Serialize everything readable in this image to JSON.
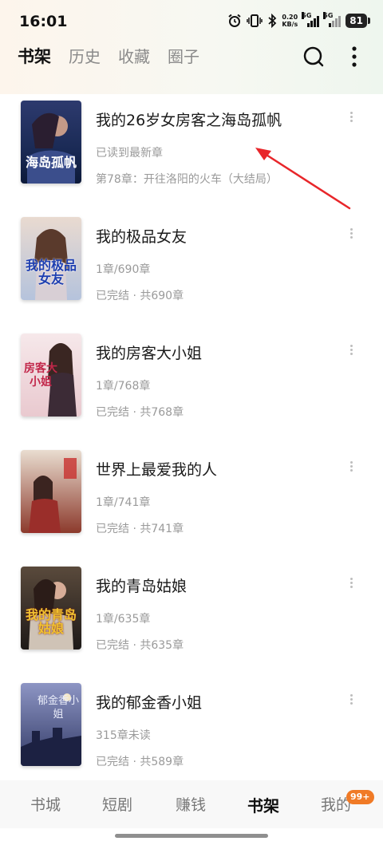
{
  "status_bar": {
    "time": "16:01",
    "net_speed_value": "0.20",
    "net_speed_unit": "KB/s",
    "sig1_label": "5G",
    "sig2_label": "5G",
    "battery": "81",
    "icons": [
      "alarm-icon",
      "vibrate-icon",
      "bluetooth-icon",
      "signal-icon",
      "signal-icon",
      "battery-icon"
    ]
  },
  "top_tabs": [
    {
      "label": "书架",
      "active": true
    },
    {
      "label": "历史",
      "active": false
    },
    {
      "label": "收藏",
      "active": false
    },
    {
      "label": "圈子",
      "active": false
    }
  ],
  "books": [
    {
      "title": "我的26岁女房客之海岛孤帆",
      "line1": "已读到最新章",
      "line2": "第78章：开往洛阳的火车（大结局）",
      "cover_text": "海岛孤帆"
    },
    {
      "title": "我的极品女友",
      "line1": "1章/690章",
      "line2": "已完结 · 共690章",
      "cover_text": "我的极品女友"
    },
    {
      "title": "我的房客大小姐",
      "line1": "1章/768章",
      "line2": "已完结 · 共768章",
      "cover_text": "房客大小姐"
    },
    {
      "title": "世界上最爱我的人",
      "line1": "1章/741章",
      "line2": "已完结 · 共741章",
      "cover_text": ""
    },
    {
      "title": "我的青岛姑娘",
      "line1": "1章/635章",
      "line2": "已完结 · 共635章",
      "cover_text": "我的青岛姑娘"
    },
    {
      "title": "我的郁金香小姐",
      "line1": "315章未读",
      "line2": "已完结 · 共589章",
      "cover_text": "郁金香小姐"
    }
  ],
  "bottom_nav": [
    {
      "label": "书城",
      "active": false
    },
    {
      "label": "短剧",
      "active": false
    },
    {
      "label": "赚钱",
      "active": false
    },
    {
      "label": "书架",
      "active": true
    },
    {
      "label": "我的",
      "active": false
    }
  ],
  "badge": "99+",
  "colors": {
    "accent_red": "#e8262a",
    "badge_orange": "#f07a26"
  }
}
